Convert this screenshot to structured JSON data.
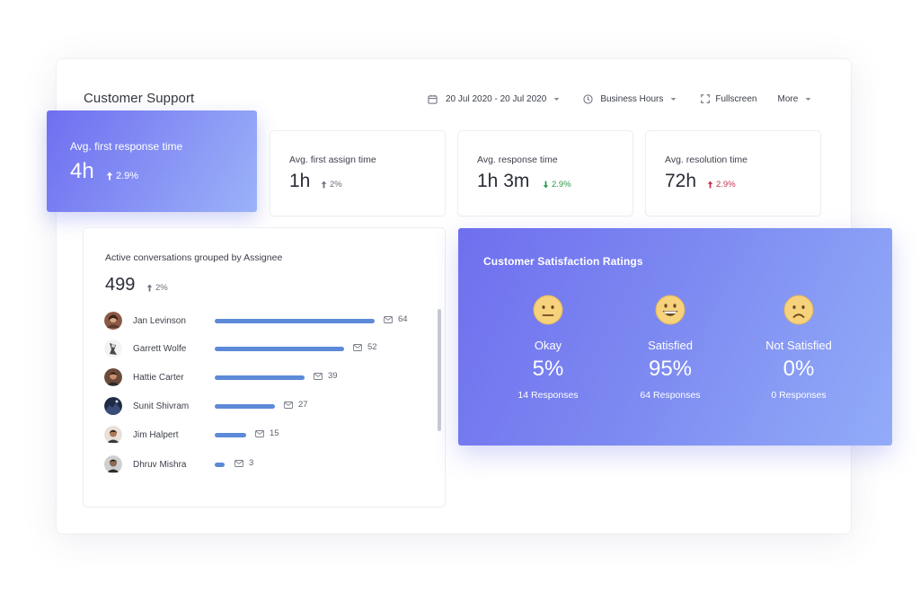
{
  "header": {
    "title": "Customer Support",
    "date_range": "20 Jul 2020 - 20 Jul 2020",
    "hours_filter": "Business Hours",
    "fullscreen_label": "Fullscreen",
    "more_label": "More"
  },
  "metrics": [
    {
      "label": "Avg. first response time",
      "value": "4h",
      "delta": "2.9%",
      "direction": "up"
    },
    {
      "label": "Avg. first assign time",
      "value": "1h",
      "delta": "2%",
      "direction": "up"
    },
    {
      "label": "Avg. response time",
      "value": "1h 3m",
      "delta": "2.9%",
      "direction": "down"
    },
    {
      "label": "Avg. resolution time",
      "value": "72h",
      "delta": "2.9%",
      "direction": "up"
    }
  ],
  "assignees": {
    "title": "Active conversations grouped by Assignee",
    "total": "499",
    "delta": "2%",
    "rows": [
      {
        "name": "Jan Levinson",
        "count": 64
      },
      {
        "name": "Garrett Wolfe",
        "count": 52
      },
      {
        "name": "Hattie Carter",
        "count": 39
      },
      {
        "name": "Sunit Shivram",
        "count": 27
      },
      {
        "name": "Jim Halpert",
        "count": 15
      },
      {
        "name": "Dhruv Mishra",
        "count": 3
      }
    ]
  },
  "csat": {
    "title": "Customer Satisfaction Ratings",
    "items": [
      {
        "label": "Okay",
        "percent": "5%",
        "responses": "14 Responses",
        "icon": "neutral-face-icon"
      },
      {
        "label": "Satisfied",
        "percent": "95%",
        "responses": "64 Responses",
        "icon": "grinning-face-icon"
      },
      {
        "label": "Not Satisfied",
        "percent": "0%",
        "responses": "0 Responses",
        "icon": "frowning-face-icon"
      }
    ]
  },
  "colors": {
    "accent_gradient_start": "#6e6ff0",
    "accent_gradient_end": "#9bb2f8",
    "bar": "#5d8ad8",
    "delta_up_neutral": "#6b6f7a",
    "delta_down": "#2e9a4a",
    "delta_up_bad": "#c2334d"
  }
}
